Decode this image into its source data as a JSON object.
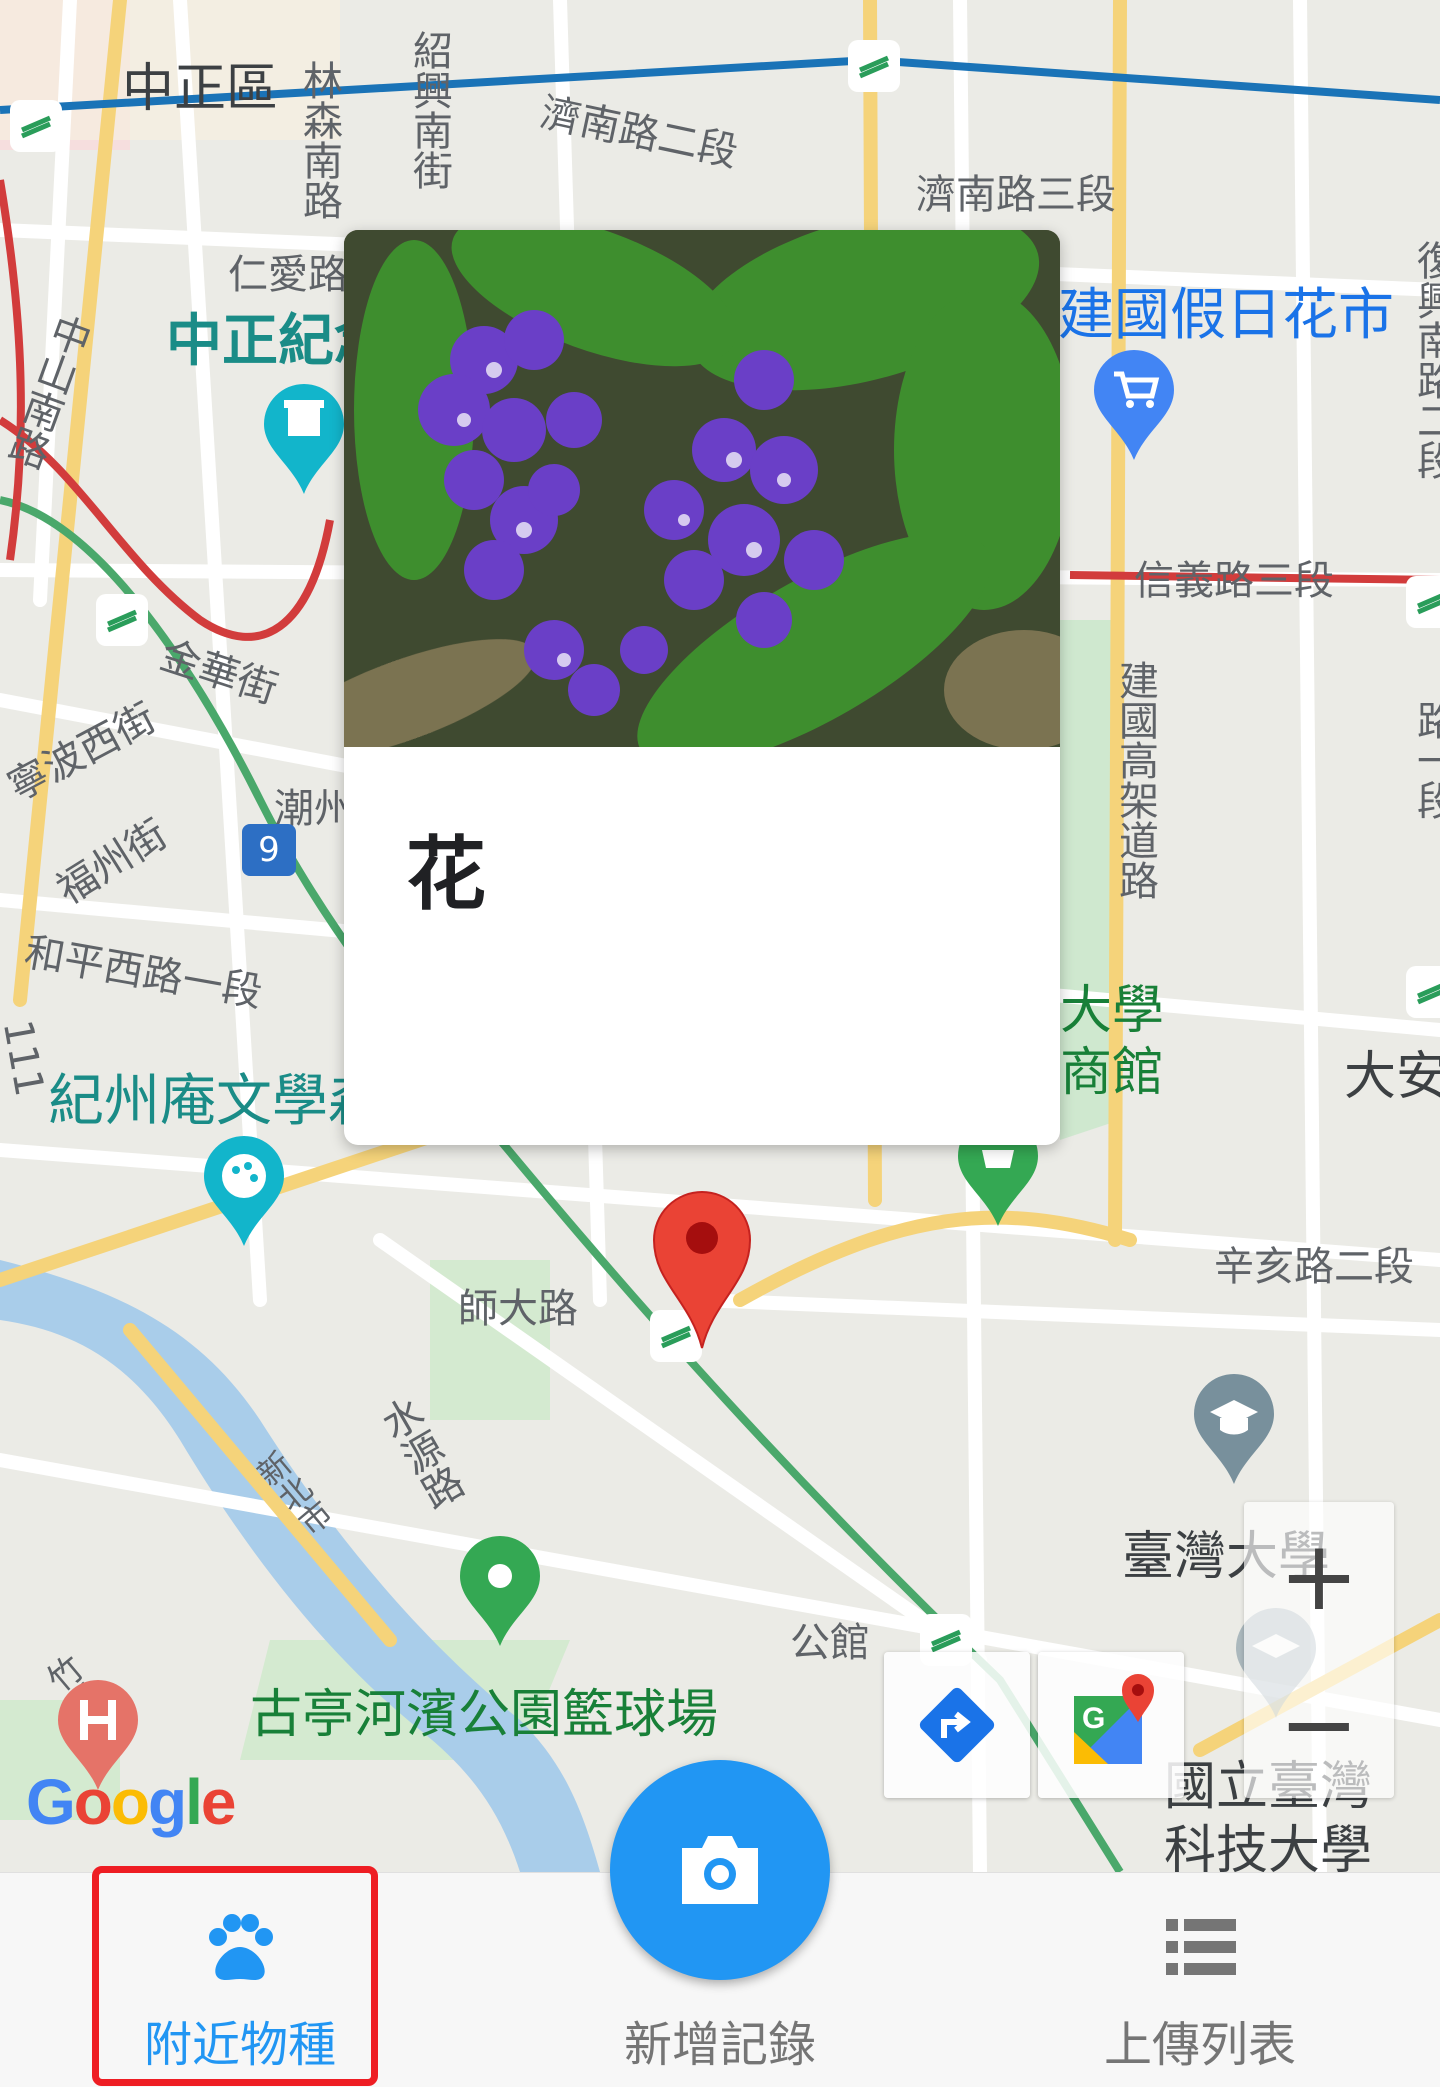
{
  "map": {
    "labels": {
      "zhongzheng": "中正區",
      "linsen_s": "林森南路",
      "shaoxing_s": "紹興南街",
      "jinan2": "濟南路二段",
      "jinan3": "濟南路三段",
      "renai": "仁愛路",
      "cks_memorial": "中正紀念",
      "jianguo_flower": "建國假日花市",
      "zhongshan_s": "中山南路",
      "xinyi3": "信義路三段",
      "jinhua": "金華街",
      "ningbo_w": "寧波西街",
      "chaozhou": "潮州",
      "fuzhou": "福州街",
      "heping_w1": "和平西路一段",
      "jianguo_elev": "建國高架道路",
      "daxue": "大學",
      "shangguan": "商館",
      "da_an": "大安",
      "jizhouan": "紀州庵文學森",
      "xinhai2": "辛亥路二段",
      "shida": "師大路",
      "shuiyuan": "水源路",
      "new_taipei": "新北市",
      "guting_park": "古亭河濱公園籃球場",
      "gongguan": "公館",
      "ntu": "臺灣大學",
      "ntust1": "國立臺灣",
      "ntust2": "科技大學",
      "route9": "9",
      "fuxing_s": "復興南路二段",
      "zhuolin": "竹林路",
      "num111": "111",
      "sec1": "路一段"
    },
    "google_logo": "Google",
    "zoom_in": "+",
    "zoom_out": "−"
  },
  "card": {
    "title": "花"
  },
  "nav": {
    "nearby": "附近物種",
    "add_record": "新增記錄",
    "upload_list": "上傳列表"
  },
  "colors": {
    "accent": "#2196f3",
    "highlight": "#ee1d23",
    "marker": "#ea4335"
  }
}
